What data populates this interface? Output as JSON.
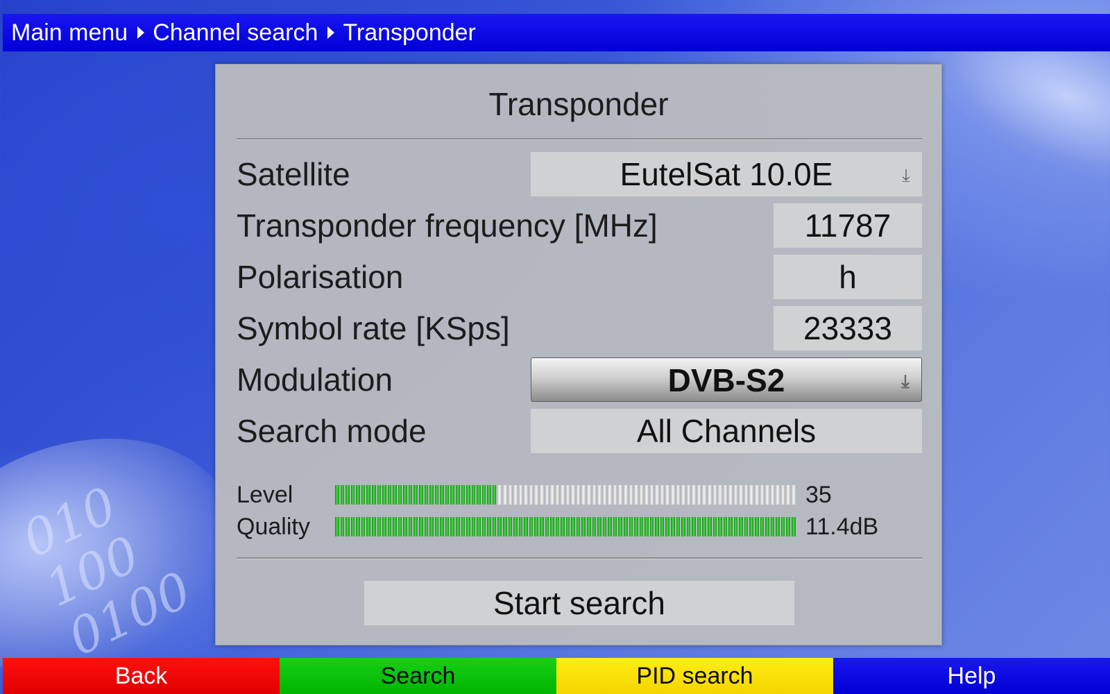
{
  "breadcrumb": [
    "Main menu",
    "Channel search",
    "Transponder"
  ],
  "panel": {
    "title": "Transponder",
    "rows": [
      {
        "label": "Satellite",
        "value": "EutelSat 10.0E",
        "type": "dropdown"
      },
      {
        "label": "Transponder frequency [MHz]",
        "value": "11787",
        "type": "field"
      },
      {
        "label": "Polarisation",
        "value": "h",
        "type": "field"
      },
      {
        "label": "Symbol rate [KSps]",
        "value": "23333",
        "type": "field"
      },
      {
        "label": "Modulation",
        "value": "DVB-S2",
        "type": "dropdown",
        "selected": true
      },
      {
        "label": "Search mode",
        "value": "All Channels",
        "type": "field"
      }
    ],
    "level": {
      "label": "Level",
      "value": "35",
      "fill_fraction": 0.35
    },
    "quality": {
      "label": "Quality",
      "value": "11.4dB",
      "fill_fraction": 1.0
    },
    "start_button": "Start search"
  },
  "function_keys": [
    {
      "label": "Back",
      "color": "#e00000"
    },
    {
      "label": "Search",
      "color": "#00b400"
    },
    {
      "label": "PID search",
      "color": "#f4d400"
    },
    {
      "label": "Help",
      "color": "#0000d4"
    }
  ],
  "icons": {
    "dropdown": "download-arrow-icon"
  }
}
